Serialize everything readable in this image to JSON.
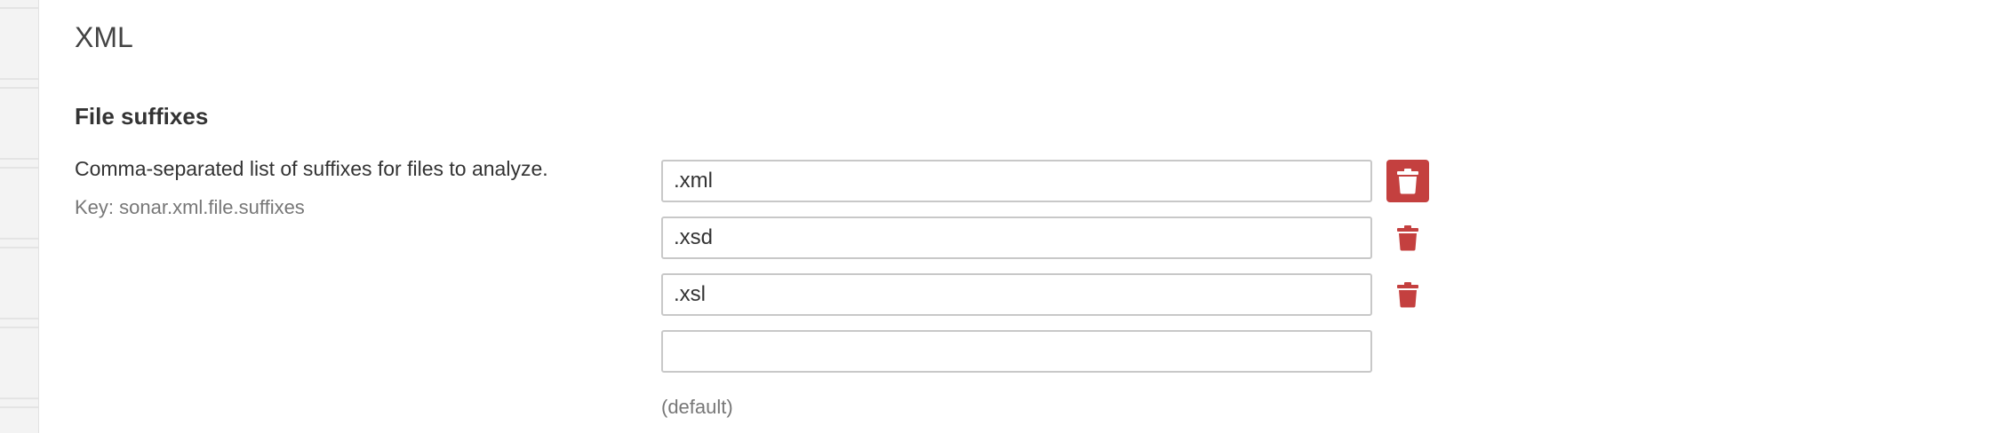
{
  "section": {
    "title": "XML"
  },
  "setting": {
    "title": "File suffixes",
    "description": "Comma-separated list of suffixes for files to analyze.",
    "key": "Key: sonar.xml.file.suffixes",
    "values": [
      {
        "value": ".xml"
      },
      {
        "value": ".xsd"
      },
      {
        "value": ".xsl"
      }
    ],
    "new_value": "",
    "default_label": "(default)"
  },
  "colors": {
    "delete_accent": "#c4403f",
    "delete_icon_on_accent": "#ffffff",
    "input_border": "#c8c8c8",
    "muted_text": "#777777"
  },
  "icons": {
    "delete": "trash-icon"
  }
}
